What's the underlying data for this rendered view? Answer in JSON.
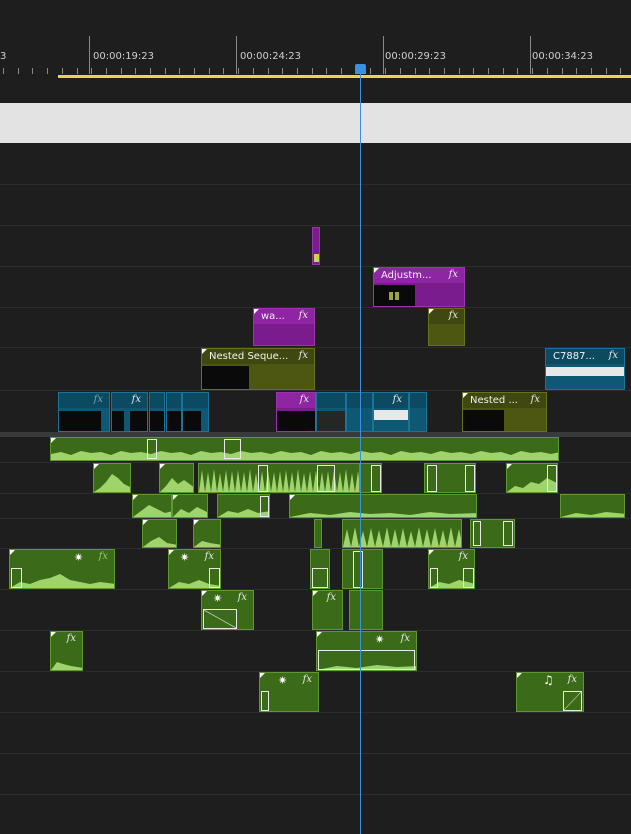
{
  "ruler": {
    "partial_label": "3",
    "timecodes": [
      "00:00:19:23",
      "00:00:24:23",
      "00:00:29:23",
      "00:00:34:23"
    ]
  },
  "clips": {
    "adjustment": "Adjustm...",
    "wa": "wa...",
    "nested_sequence_1": "Nested Seque...",
    "nested_sequence_2": "Nested ...",
    "c7887": "C7887..."
  },
  "glyphs": {
    "fx": "fx",
    "star": "✷",
    "note": "♫"
  },
  "colors": {
    "playhead": "#3d8fe0",
    "work_area": "#e6d84a",
    "video_clip": "#4e5712",
    "adjustment_clip": "#7a1c8c",
    "teal_clip": "#0f5873",
    "audio_clip": "#3b6b18"
  }
}
